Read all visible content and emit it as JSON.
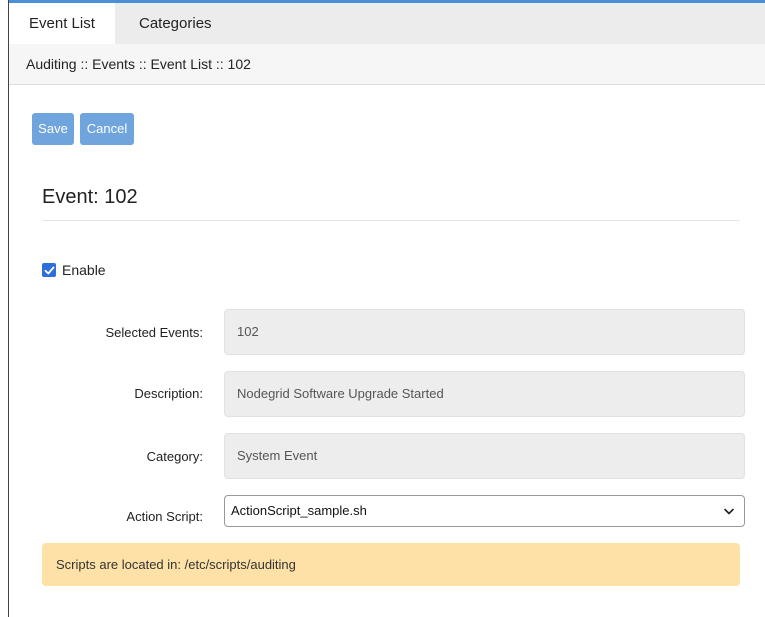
{
  "tabs": [
    {
      "label": "Event List",
      "active": true
    },
    {
      "label": "Categories",
      "active": false
    }
  ],
  "breadcrumb": "Auditing :: Events :: Event List :: 102",
  "toolbar": {
    "save_label": "Save",
    "cancel_label": "Cancel"
  },
  "page_title": "Event: 102",
  "enable": {
    "label": "Enable",
    "checked": true
  },
  "fields": {
    "selected_events": {
      "label": "Selected Events:",
      "value": "102"
    },
    "description": {
      "label": "Description:",
      "value": "Nodegrid Software Upgrade Started"
    },
    "category": {
      "label": "Category:",
      "value": "System Event"
    },
    "action_script": {
      "label": "Action Script:",
      "value": "ActionScript_sample.sh"
    }
  },
  "notice": "Scripts are located in: /etc/scripts/auditing",
  "colors": {
    "accent": "#4a90d9",
    "button": "#6fa4dd",
    "checkbox": "#2f6fdc",
    "notice_bg": "#fde1a6"
  },
  "icons": {
    "checkbox": "check-icon",
    "select": "chevron-down-icon"
  }
}
